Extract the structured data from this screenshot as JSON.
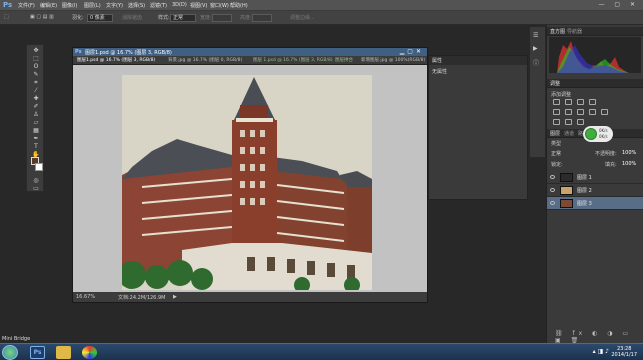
{
  "app": {
    "logo": "Ps"
  },
  "menu": [
    "文件(F)",
    "编辑(E)",
    "图像(I)",
    "图层(L)",
    "文字(Y)",
    "选择(S)",
    "滤镜(T)",
    "3D(D)",
    "视图(V)",
    "窗口(W)",
    "帮助(H)"
  ],
  "window_controls": "— ▢ ✕",
  "options": {
    "feather_label": "羽化:",
    "feather_value": "0 像素",
    "antialias": "消除锯齿",
    "style_label": "样式:",
    "style_value": "正常",
    "width_label": "宽度:",
    "height_label": "高度:",
    "refine": "调整边缘..."
  },
  "document": {
    "title": "图层1.psd @ 16.7% (图层 3, RGB/8)",
    "tabs": [
      "图层1.psd @ 16.7% (图层 3, RGB/8)",
      "背景.jpg @ 16.7% (图层 0, RGB/8)",
      "图层 1.psd @ 16.7% (图层 3, RGB/8)",
      "图层拼合",
      "新增图层.jpg @ 100%(RGB/8)"
    ],
    "zoom": "16.67%",
    "doc_info": "文档:24.2M/126.9M"
  },
  "properties": {
    "title": "属性",
    "body": "无属性"
  },
  "panels": {
    "histogram_tabs": [
      "直方图",
      "导航器"
    ],
    "adjust_tab": "调整",
    "adjust_add": "添加调整",
    "layers_tabs": [
      "图层",
      "通道",
      "路径"
    ],
    "kind_label": "类型",
    "blend_mode": "正常",
    "opacity_label": "不透明度:",
    "opacity_value": "100%",
    "lock_label": "锁定:",
    "fill_label": "填充:",
    "fill_value": "100%"
  },
  "layers": [
    {
      "name": "图层 1",
      "selected": false
    },
    {
      "name": "图层 2",
      "selected": false
    },
    {
      "name": "图层 3",
      "selected": true
    }
  ],
  "zoom_bubble": {
    "top": "0K/s",
    "bottom": "0K/s"
  },
  "taskbar": {
    "mini_bridge": "Mini Bridge",
    "time": "23:28",
    "date": "2014/1/17"
  },
  "colors": {
    "accent": "#3f5f83",
    "selected_layer": "#586d88",
    "fg": "#5a3a2a"
  }
}
